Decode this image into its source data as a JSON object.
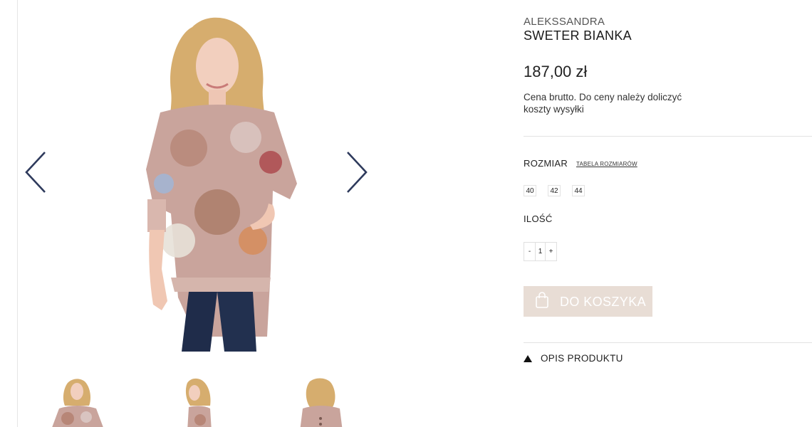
{
  "gallery": {
    "prev_icon": "chevron-left-icon",
    "next_icon": "chevron-right-icon",
    "thumbnails": [
      "front",
      "side",
      "back"
    ]
  },
  "product": {
    "brand": "ALEKSSANDRA",
    "name": "SWETER BIANKA",
    "price": "187,00 zł",
    "price_note": "Cena brutto. Do ceny należy doliczyć koszty wysyłki"
  },
  "size": {
    "label": "ROZMIAR",
    "table_link": "TABELA ROZMIARÓW",
    "options": [
      "40",
      "42",
      "44"
    ]
  },
  "quantity": {
    "label": "ILOŚĆ",
    "minus": "-",
    "value": "1",
    "plus": "+"
  },
  "cart": {
    "label": "DO KOSZYKA",
    "icon": "shopping-bag-icon"
  },
  "description": {
    "label": "OPIS PRODUKTU",
    "icon": "triangle-up-icon"
  },
  "colors": {
    "accent": "#2e3a5c",
    "cart_bg": "#e8ddd5",
    "blouse": "#c9a49c",
    "jeans": "#1f2c4a"
  }
}
